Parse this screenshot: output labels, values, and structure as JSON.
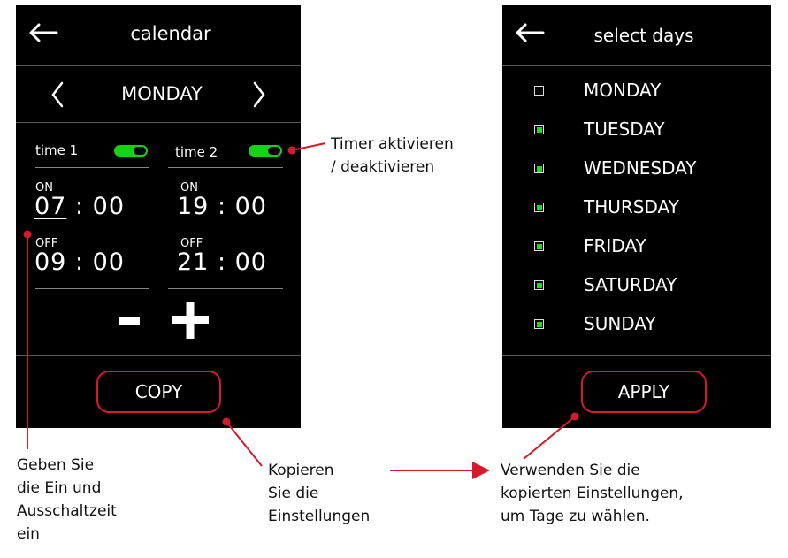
{
  "left_screen": {
    "title": "calendar",
    "back_icon": "arrow-left-icon",
    "day": "MONDAY",
    "prev_icon": "chevron-left-icon",
    "next_icon": "chevron-right-icon",
    "time1": {
      "label": "time 1",
      "enabled": true,
      "on_label": "ON",
      "on_hour": "07",
      "on_minute": "00",
      "off_label": "OFF",
      "off_time": "09 : 00"
    },
    "time2": {
      "label": "time 2",
      "enabled": true,
      "on_label": "ON",
      "on_time": "19 : 00",
      "off_label": "OFF",
      "off_time": "21 : 00"
    },
    "minus_label": "−",
    "plus_label": "+",
    "copy_label": "COPY"
  },
  "right_screen": {
    "title": "select days",
    "back_icon": "arrow-left-icon",
    "days": [
      {
        "label": "MONDAY",
        "checked": false
      },
      {
        "label": "TUESDAY",
        "checked": true
      },
      {
        "label": "WEDNESDAY",
        "checked": true
      },
      {
        "label": "THURSDAY",
        "checked": true
      },
      {
        "label": "FRIDAY",
        "checked": true
      },
      {
        "label": "SATURDAY",
        "checked": true
      },
      {
        "label": "SUNDAY",
        "checked": true
      }
    ],
    "apply_label": "APPLY"
  },
  "annotations": {
    "timer_toggle": [
      "Timer aktivieren",
      "/ deaktivieren"
    ],
    "set_times": [
      "Geben Sie",
      "die Ein und",
      "Ausschaltzeit",
      "ein"
    ],
    "copy_settings": [
      "Kopieren",
      "Sie die",
      "Einstellungen"
    ],
    "use_settings": [
      "Verwenden Sie die",
      "kopierten Einstellungen,",
      "um Tage zu wählen."
    ]
  },
  "colors": {
    "screen_bg": "#000000",
    "accent_red": "#d61a2a",
    "toggle_green": "#17d317",
    "check_green": "#22d822"
  }
}
